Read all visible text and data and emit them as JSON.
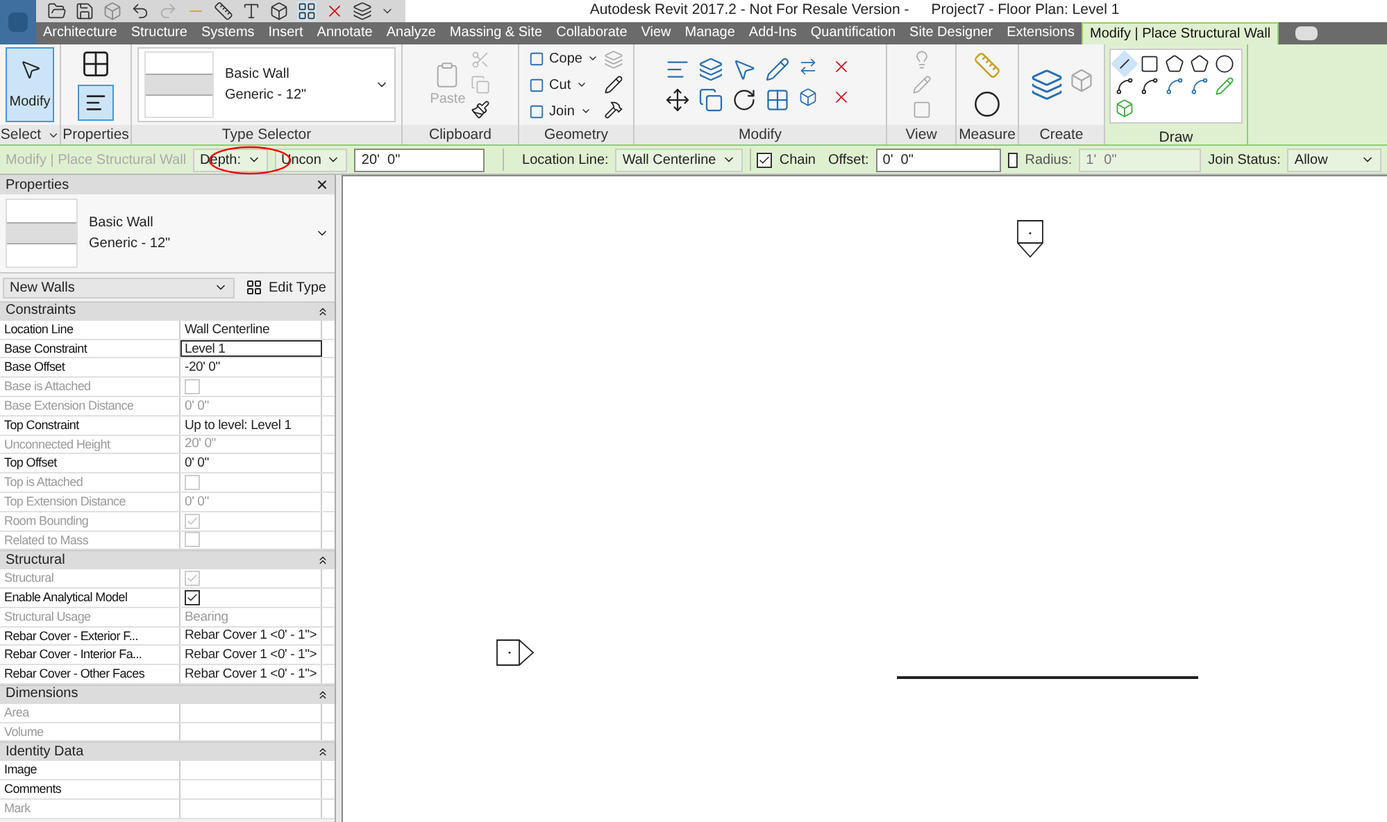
{
  "window": {
    "title": "Autodesk Revit 2017.2 - Not For Resale Version -",
    "document": "Project7 - Floor Plan: Level 1"
  },
  "tabs": [
    {
      "label": "Architecture",
      "selected": false
    },
    {
      "label": "Structure",
      "selected": false
    },
    {
      "label": "Systems",
      "selected": false
    },
    {
      "label": "Insert",
      "selected": false
    },
    {
      "label": "Annotate",
      "selected": false
    },
    {
      "label": "Analyze",
      "selected": false
    },
    {
      "label": "Massing & Site",
      "selected": false
    },
    {
      "label": "Collaborate",
      "selected": false
    },
    {
      "label": "View",
      "selected": false
    },
    {
      "label": "Manage",
      "selected": false
    },
    {
      "label": "Add-Ins",
      "selected": false
    },
    {
      "label": "Quantification",
      "selected": false
    },
    {
      "label": "Site Designer",
      "selected": false
    },
    {
      "label": "Extensions",
      "selected": false
    },
    {
      "label": "Modify | Place Structural Wall",
      "selected": true
    }
  ],
  "ribbon": {
    "modify_button": {
      "label": "Modify",
      "selected": true
    },
    "type_selector": {
      "family": "Basic Wall",
      "type": "Generic - 12\""
    },
    "paste": "Paste",
    "geometry": [
      "Cope",
      "Cut",
      "Join"
    ],
    "panels": [
      "Select",
      "Properties",
      "Type Selector",
      "Clipboard",
      "Geometry",
      "Modify",
      "View",
      "Measure",
      "Create",
      "Draw"
    ]
  },
  "options_bar": {
    "context": "Modify | Place Structural Wall",
    "depth": "Depth:",
    "height_mode": "Uncon",
    "height": "20'  0\"",
    "location_label": "Location Line:",
    "location": "Wall Centerline",
    "chain": {
      "label": "Chain",
      "checked": true
    },
    "offset_label": "Offset:",
    "offset": "0'  0\"",
    "radius": {
      "label": "Radius:",
      "checked": false,
      "value": "1'  0\""
    },
    "join_label": "Join Status:",
    "join": "Allow"
  },
  "properties": {
    "title": "Properties",
    "family": "Basic Wall",
    "type": "Generic - 12\"",
    "filter": "New Walls",
    "edit_type": "Edit Type",
    "groups": [
      {
        "name": "Constraints",
        "rows": [
          {
            "label": "Location Line",
            "kind": "text",
            "value": "Wall Centerline",
            "disabled": false
          },
          {
            "label": "Base Constraint",
            "kind": "text",
            "value": "Level 1",
            "disabled": false,
            "selected": true
          },
          {
            "label": "Base Offset",
            "kind": "text",
            "value": "-20'  0\"",
            "disabled": false
          },
          {
            "label": "Base is Attached",
            "kind": "checkbox",
            "checked": false,
            "disabled": true
          },
          {
            "label": "Base Extension Distance",
            "kind": "text",
            "value": "0'  0\"",
            "disabled": true
          },
          {
            "label": "Top Constraint",
            "kind": "text",
            "value": "Up to level: Level 1",
            "disabled": false
          },
          {
            "label": "Unconnected Height",
            "kind": "text",
            "value": "20'  0\"",
            "disabled": true
          },
          {
            "label": "Top Offset",
            "kind": "text",
            "value": "0'  0\"",
            "disabled": false
          },
          {
            "label": "Top is Attached",
            "kind": "checkbox",
            "checked": false,
            "disabled": true
          },
          {
            "label": "Top Extension Distance",
            "kind": "text",
            "value": "0'  0\"",
            "disabled": true
          },
          {
            "label": "Room Bounding",
            "kind": "checkbox",
            "checked": true,
            "disabled": true
          },
          {
            "label": "Related to Mass",
            "kind": "checkbox",
            "checked": false,
            "disabled": true
          }
        ]
      },
      {
        "name": "Structural",
        "rows": [
          {
            "label": "Structural",
            "kind": "checkbox",
            "checked": true,
            "disabled": true
          },
          {
            "label": "Enable Analytical Model",
            "kind": "checkbox",
            "checked": true,
            "disabled": false
          },
          {
            "label": "Structural Usage",
            "kind": "text",
            "value": "Bearing",
            "disabled": true
          },
          {
            "label": "Rebar Cover - Exterior F...",
            "kind": "text",
            "value": "Rebar Cover 1 <0' - 1\">",
            "disabled": false
          },
          {
            "label": "Rebar Cover - Interior Fa...",
            "kind": "text",
            "value": "Rebar Cover 1 <0' - 1\">",
            "disabled": false
          },
          {
            "label": "Rebar Cover - Other Faces",
            "kind": "text",
            "value": "Rebar Cover 1 <0' - 1\">",
            "disabled": false
          }
        ]
      },
      {
        "name": "Dimensions",
        "rows": [
          {
            "label": "Area",
            "kind": "text",
            "disabled": true
          },
          {
            "label": "Volume",
            "kind": "text",
            "disabled": true
          }
        ]
      },
      {
        "name": "Identity Data",
        "rows": [
          {
            "label": "Image",
            "kind": "text",
            "disabled": false
          },
          {
            "label": "Comments",
            "kind": "text",
            "disabled": false
          },
          {
            "label": "Mark",
            "kind": "text",
            "disabled": true
          }
        ]
      }
    ]
  }
}
